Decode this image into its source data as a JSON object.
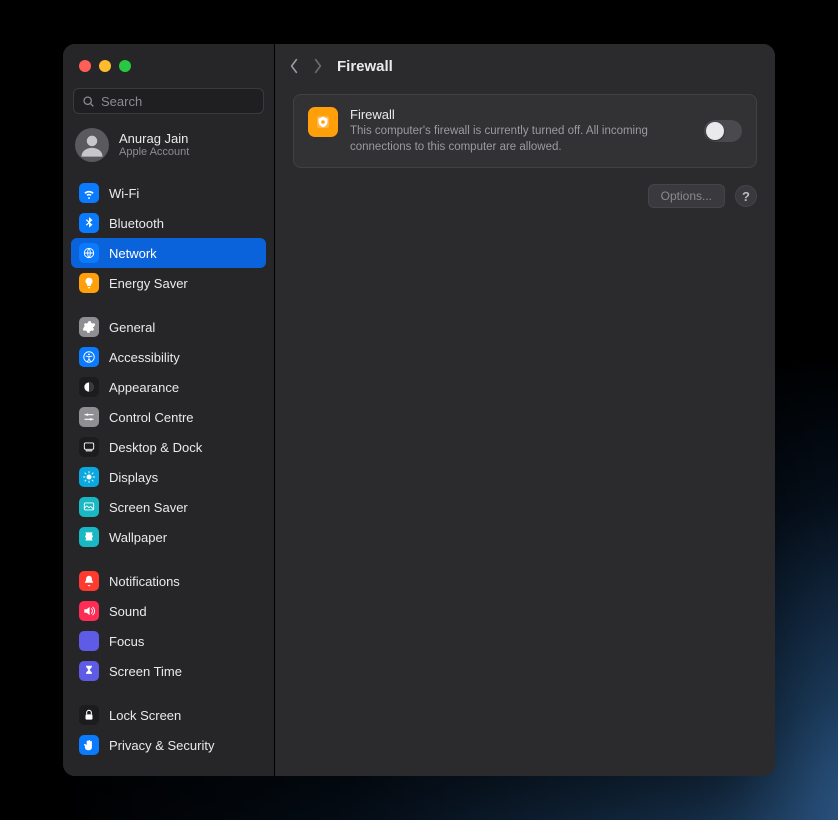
{
  "search": {
    "placeholder": "Search"
  },
  "account": {
    "name": "Anurag Jain",
    "sub": "Apple Account"
  },
  "header": {
    "title": "Firewall"
  },
  "card": {
    "title": "Firewall",
    "desc": "This computer's firewall is currently turned off. All incoming connections to this computer are allowed."
  },
  "footer": {
    "options": "Options...",
    "help": "?"
  },
  "sidebar": {
    "groups": [
      [
        {
          "label": "Wi-Fi",
          "icon": "wifi",
          "color": "#0a7aff",
          "selected": false
        },
        {
          "label": "Bluetooth",
          "icon": "bluetooth",
          "color": "#0a7aff",
          "selected": false
        },
        {
          "label": "Network",
          "icon": "globe",
          "color": "#0a7aff",
          "selected": true
        },
        {
          "label": "Energy Saver",
          "icon": "bulb",
          "color": "#ff9f0a",
          "selected": false
        }
      ],
      [
        {
          "label": "General",
          "icon": "gear",
          "color": "#8e8e93",
          "selected": false
        },
        {
          "label": "Accessibility",
          "icon": "accessibility",
          "color": "#0a7aff",
          "selected": false
        },
        {
          "label": "Appearance",
          "icon": "appearance",
          "color": "#1c1c1e",
          "selected": false
        },
        {
          "label": "Control Centre",
          "icon": "sliders",
          "color": "#8e8e93",
          "selected": false
        },
        {
          "label": "Desktop & Dock",
          "icon": "dock",
          "color": "#1c1c1e",
          "selected": false
        },
        {
          "label": "Displays",
          "icon": "displays",
          "color": "#0aa8e0",
          "selected": false
        },
        {
          "label": "Screen Saver",
          "icon": "screensaver",
          "color": "#18b8c5",
          "selected": false
        },
        {
          "label": "Wallpaper",
          "icon": "wallpaper",
          "color": "#18b8c5",
          "selected": false
        }
      ],
      [
        {
          "label": "Notifications",
          "icon": "bell",
          "color": "#ff3b30",
          "selected": false
        },
        {
          "label": "Sound",
          "icon": "speaker",
          "color": "#ff2d55",
          "selected": false
        },
        {
          "label": "Focus",
          "icon": "moon",
          "color": "#5e5ce6",
          "selected": false
        },
        {
          "label": "Screen Time",
          "icon": "hourglass",
          "color": "#5e5ce6",
          "selected": false
        }
      ],
      [
        {
          "label": "Lock Screen",
          "icon": "lock",
          "color": "#1c1c1e",
          "selected": false
        },
        {
          "label": "Privacy & Security",
          "icon": "hand",
          "color": "#0a7aff",
          "selected": false
        }
      ]
    ]
  }
}
